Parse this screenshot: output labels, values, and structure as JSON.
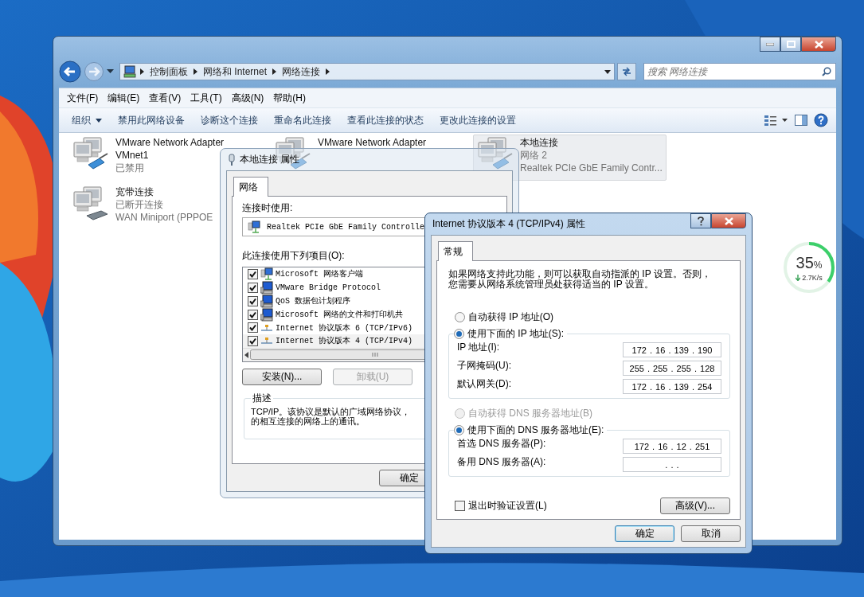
{
  "explorer": {
    "breadcrumb": [
      "控制面板",
      "网络和 Internet",
      "网络连接"
    ],
    "search": {
      "placeholder": "搜索 网络连接"
    },
    "menu": [
      "文件(F)",
      "编辑(E)",
      "查看(V)",
      "工具(T)",
      "高级(N)",
      "帮助(H)"
    ],
    "toolbar": [
      {
        "label": "组织",
        "dropdown": true
      },
      {
        "label": "禁用此网络设备",
        "dropdown": false
      },
      {
        "label": "诊断这个连接",
        "dropdown": false
      },
      {
        "label": "重命名此连接",
        "dropdown": false
      },
      {
        "label": "查看此连接的状态",
        "dropdown": false
      },
      {
        "label": "更改此连接的设置",
        "dropdown": false
      }
    ],
    "adapters": [
      {
        "kind": "ethernet",
        "name": [
          "VMware Network Adapter",
          "VMnet1"
        ],
        "details": [
          "已禁用"
        ],
        "selected": false
      },
      {
        "kind": "ethernet",
        "name": [
          "VMware Network Adapter"
        ],
        "selected": false
      },
      {
        "kind": "ethernet",
        "name": [
          "本地连接"
        ],
        "details": [
          "网络  2",
          "Realtek PCIe GbE Family Contr..."
        ],
        "selected": true
      },
      {
        "kind": "broadband",
        "name": [
          "宽带连接"
        ],
        "details": [
          "已断开连接",
          "WAN Miniport (PPPOE"
        ],
        "selected": false
      }
    ]
  },
  "properties_dialog": {
    "title": "本地连接 属性",
    "tabs": [
      {
        "label": "网络",
        "selected": true
      }
    ],
    "connect_using_label": "连接时使用:",
    "adapter": "Realtek PCIe GbE Family Controlle",
    "items_label": "此连接使用下列项目(O):",
    "items": [
      {
        "kind": "client",
        "label": "Microsoft 网络客户端",
        "checked": true,
        "selected": false
      },
      {
        "kind": "service",
        "label": "VMware Bridge Protocol",
        "checked": true,
        "selected": false
      },
      {
        "kind": "service",
        "label": "QoS 数据包计划程序",
        "checked": true,
        "selected": false
      },
      {
        "kind": "service",
        "label": "Microsoft 网络的文件和打印机共",
        "checked": true,
        "selected": false
      },
      {
        "kind": "protocol",
        "label": "Internet 协议版本 6 (TCP/IPv6)",
        "checked": true,
        "selected": false
      },
      {
        "kind": "protocol",
        "label": "Internet 协议版本 4 (TCP/IPv4)",
        "checked": true,
        "selected": true
      }
    ],
    "buttons": [
      {
        "label": "安装(N)...",
        "disabled": false
      },
      {
        "label": "卸载(U)",
        "disabled": true
      }
    ],
    "description": {
      "title": "描述",
      "text": "TCP/IP。该协议是默认的广域网络协议，的相互连接的网络上的通讯。"
    },
    "ok": "确定"
  },
  "tcp_dialog": {
    "title": "Internet 协议版本 4 (TCP/IPv4) 属性",
    "tabs": [
      {
        "label": "常规",
        "selected": true
      }
    ],
    "intro": "如果网络支持此功能，则可以获取自动指派的 IP 设置。否则，您需要从网络系统管理员处获得适当的 IP 设置。",
    "ip": {
      "options": [
        {
          "label": "自动获得 IP 地址(O)",
          "selected": false,
          "disabled": false
        },
        {
          "label": "使用下面的 IP 地址(S):",
          "selected": true,
          "disabled": false
        }
      ],
      "fields": [
        {
          "label": "IP 地址(I):",
          "value": "172 . 16 . 139 . 190"
        },
        {
          "label": "子网掩码(U):",
          "value": "255 . 255 . 255 . 128"
        },
        {
          "label": "默认网关(D):",
          "value": "172 . 16 . 139 . 254"
        }
      ]
    },
    "dns": {
      "options": [
        {
          "label": "自动获得 DNS 服务器地址(B)",
          "selected": false,
          "disabled": true
        },
        {
          "label": "使用下面的 DNS 服务器地址(E):",
          "selected": true,
          "disabled": false
        }
      ],
      "fields": [
        {
          "label": "首选 DNS 服务器(P):",
          "value": "172 . 16 . 12 . 251"
        },
        {
          "label": "备用 DNS 服务器(A):",
          "value": ". . ."
        }
      ]
    },
    "validate": {
      "label": "退出时验证设置(L)",
      "checked": false
    },
    "advanced": "高级(V)...",
    "buttons": [
      "确定",
      "取消"
    ]
  },
  "speed_widget": {
    "percent": "35",
    "unit": "%",
    "speed": "2.7K/s",
    "level": 0.35
  }
}
